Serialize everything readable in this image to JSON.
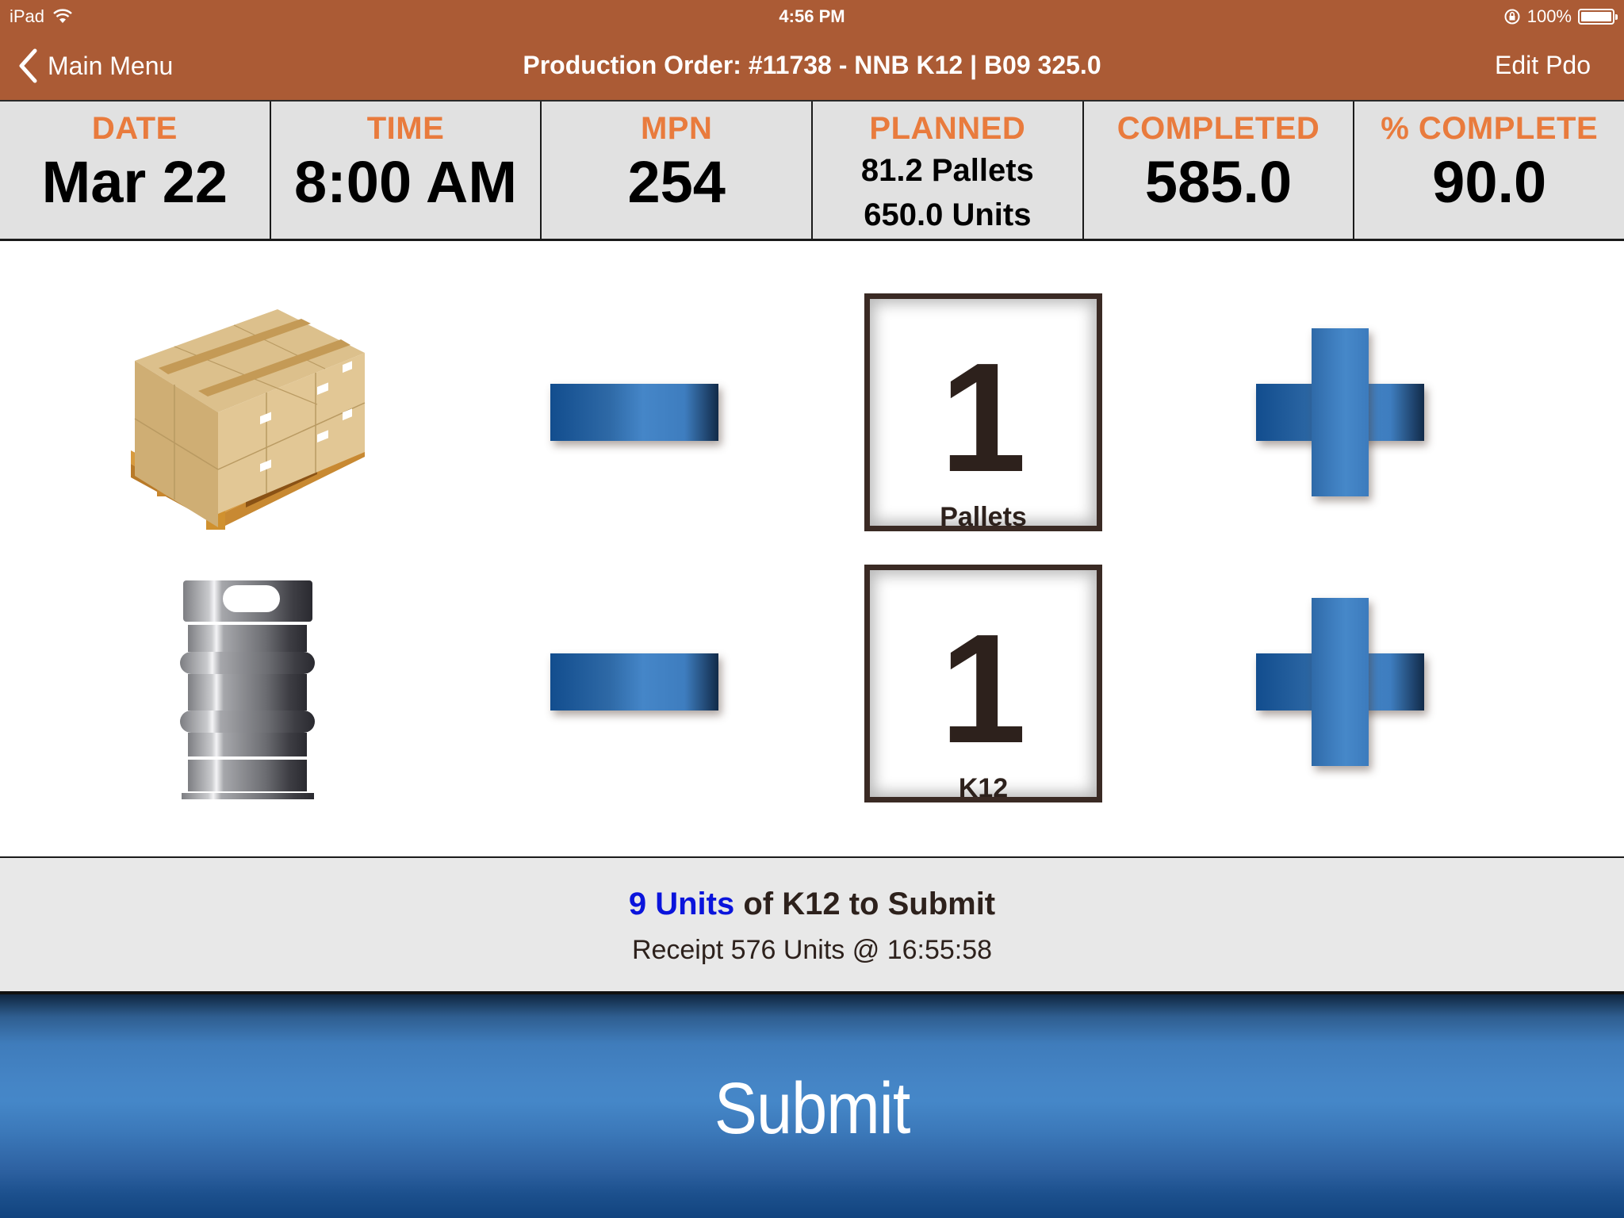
{
  "status_bar": {
    "device": "iPad",
    "time": "4:56 PM",
    "battery": "100%",
    "battery_level": 1.0,
    "icons": [
      "wifi-icon",
      "rotation-lock-icon",
      "battery-icon"
    ]
  },
  "nav": {
    "back_label": "Main Menu",
    "title": "Production Order: #11738 - NNB K12 | B09 325.0",
    "edit_label": "Edit Pdo"
  },
  "stats": [
    {
      "label": "DATE",
      "value": "Mar 22"
    },
    {
      "label": "TIME",
      "value": "8:00 AM"
    },
    {
      "label": "MPN",
      "value": "254"
    },
    {
      "label": "PLANNED",
      "value_line1": "81.2 Pallets",
      "value_line2": "650.0 Units"
    },
    {
      "label": "COMPLETED",
      "value": "585.0"
    },
    {
      "label": "% COMPLETE",
      "value": "90.0"
    }
  ],
  "entries": [
    {
      "product": "pallet",
      "icon": "pallet-icon",
      "count": "1",
      "unit": "Pallets"
    },
    {
      "product": "keg",
      "icon": "keg-icon",
      "count": "1",
      "unit": "K12"
    }
  ],
  "summary": {
    "highlight": "9 Units",
    "rest": " of K12 to Submit",
    "receipt": "Receipt 576 Units @ 16:55:58"
  },
  "submit_label": "Submit",
  "colors": {
    "header_bg": "#ab5b35",
    "stat_label": "#e97b3d",
    "highlight_blue": "#0a14dc",
    "button_blue": "#4586c8"
  }
}
